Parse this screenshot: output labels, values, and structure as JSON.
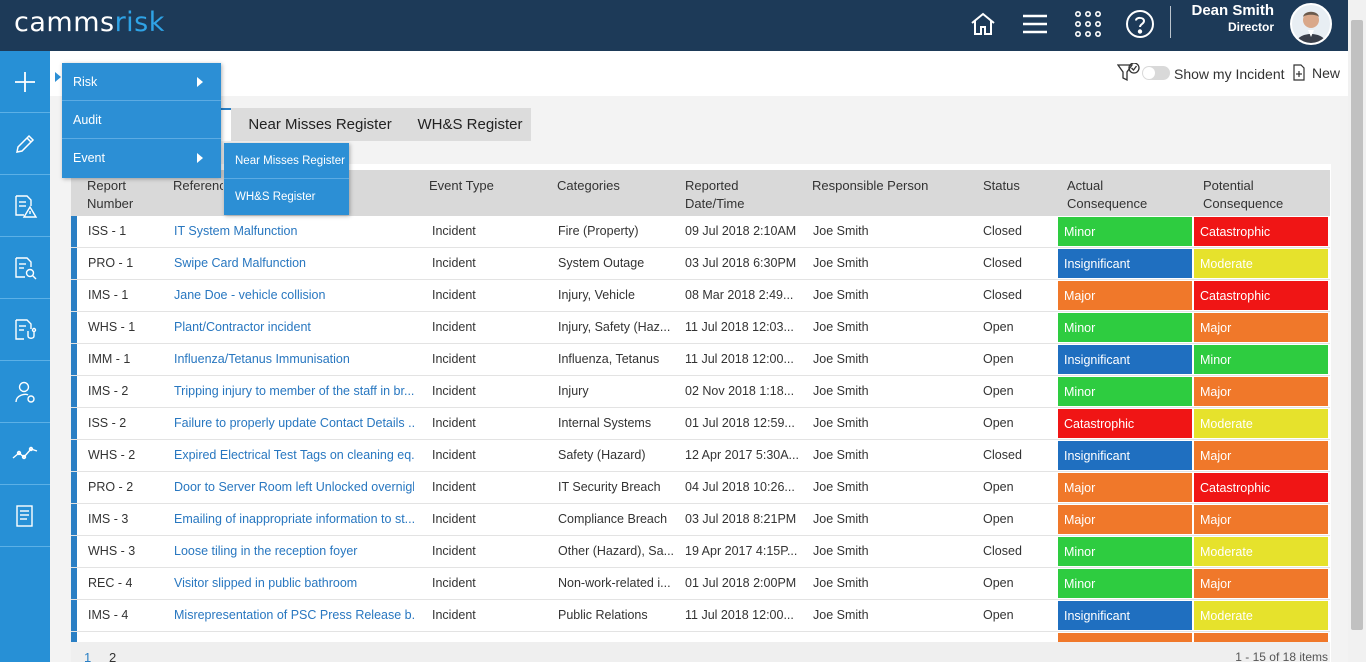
{
  "app": {
    "logo_main": "camms",
    "logo_accent": "risk"
  },
  "user": {
    "name": "Dean Smith",
    "role": "Director"
  },
  "toolbar": {
    "show_label": "Show my Incident",
    "new_label": "New"
  },
  "tabs": [
    {
      "label": "Near Misses Register"
    },
    {
      "label": "WH&S Register"
    }
  ],
  "menu": {
    "items": [
      {
        "label": "Risk"
      },
      {
        "label": "Audit"
      },
      {
        "label": "Event"
      }
    ],
    "submenu": [
      {
        "label": "Near Misses Register"
      },
      {
        "label": "WH&S Register"
      }
    ]
  },
  "grid": {
    "headers": {
      "report_number": "Report Number",
      "reference": "Referenc",
      "event_type": "Event Type",
      "categories": "Categories",
      "reported": "Reported Date/Time",
      "responsible": "Responsible Person",
      "status": "Status",
      "actual": "Actual Consequence",
      "potential": "Potential Consequence"
    },
    "rows": [
      {
        "num": "ISS - 1",
        "title": "IT System Malfunction",
        "type": "Incident",
        "cat": "Fire (Property)",
        "date": "09 Jul 2018 2:10AM",
        "person": "Joe Smith",
        "status": "Closed",
        "actual": "Minor",
        "potential": "Catastrophic"
      },
      {
        "num": "PRO - 1",
        "title": "Swipe Card Malfunction",
        "type": "Incident",
        "cat": "System Outage",
        "date": "03 Jul 2018 6:30PM",
        "person": "Joe Smith",
        "status": "Closed",
        "actual": "Insignificant",
        "potential": "Moderate"
      },
      {
        "num": "IMS - 1",
        "title": "Jane Doe - vehicle collision",
        "type": "Incident",
        "cat": "Injury, Vehicle",
        "date": "08 Mar 2018 2:49...",
        "person": "Joe Smith",
        "status": "Closed",
        "actual": "Major",
        "potential": "Catastrophic"
      },
      {
        "num": "WHS - 1",
        "title": "Plant/Contractor incident",
        "type": "Incident",
        "cat": "Injury, Safety (Haz...",
        "date": "11 Jul 2018 12:03...",
        "person": "Joe Smith",
        "status": "Open",
        "actual": "Minor",
        "potential": "Major"
      },
      {
        "num": "IMM - 1",
        "title": "Influenza/Tetanus Immunisation",
        "type": "Incident",
        "cat": "Influenza, Tetanus",
        "date": "11 Jul 2018 12:00...",
        "person": "Joe Smith",
        "status": "Open",
        "actual": "Insignificant",
        "potential": "Minor"
      },
      {
        "num": "IMS - 2",
        "title": "Tripping injury to member of the staff in br...",
        "type": "Incident",
        "cat": "Injury",
        "date": "02 Nov 2018 1:18...",
        "person": "Joe Smith",
        "status": "Open",
        "actual": "Minor",
        "potential": "Major"
      },
      {
        "num": "ISS - 2",
        "title": "Failure to properly update Contact Details ...",
        "type": "Incident",
        "cat": "Internal Systems",
        "date": "01 Jul 2018 12:59...",
        "person": "Joe Smith",
        "status": "Open",
        "actual": "Catastrophic",
        "potential": "Moderate"
      },
      {
        "num": "WHS - 2",
        "title": "Expired Electrical Test Tags on cleaning eq...",
        "type": "Incident",
        "cat": "Safety (Hazard)",
        "date": "12 Apr 2017 5:30A...",
        "person": "Joe Smith",
        "status": "Closed",
        "actual": "Insignificant",
        "potential": "Major"
      },
      {
        "num": "PRO - 2",
        "title": "Door to Server Room left Unlocked overnight",
        "type": "Incident",
        "cat": "IT Security Breach",
        "date": "04 Jul 2018 10:26...",
        "person": "Joe Smith",
        "status": "Open",
        "actual": "Major",
        "potential": "Catastrophic"
      },
      {
        "num": "IMS - 3",
        "title": "Emailing of inappropriate information to st...",
        "type": "Incident",
        "cat": "Compliance Breach",
        "date": "03 Jul 2018 8:21PM",
        "person": "Joe Smith",
        "status": "Open",
        "actual": "Major",
        "potential": "Major"
      },
      {
        "num": "WHS - 3",
        "title": "Loose tiling in the reception foyer",
        "type": "Incident",
        "cat": "Other (Hazard), Sa...",
        "date": "19 Apr 2017 4:15P...",
        "person": "Joe Smith",
        "status": "Closed",
        "actual": "Minor",
        "potential": "Moderate"
      },
      {
        "num": "REC - 4",
        "title": "Visitor slipped in public bathroom",
        "type": "Incident",
        "cat": "Non-work-related i...",
        "date": "01 Jul 2018 2:00PM",
        "person": "Joe Smith",
        "status": "Open",
        "actual": "Minor",
        "potential": "Major"
      },
      {
        "num": "IMS - 4",
        "title": "Misrepresentation of PSC Press Release b...",
        "type": "Incident",
        "cat": "Public Relations",
        "date": "11 Jul 2018 12:00...",
        "person": "Joe Smith",
        "status": "Open",
        "actual": "Insignificant",
        "potential": "Moderate"
      }
    ]
  },
  "pager": {
    "page1": "1",
    "page2": "2",
    "summary": "1 - 15 of 18 items"
  },
  "colors": {
    "Minor": "#2ecc40",
    "Insignificant": "#1f6fc0",
    "Major": "#f0782a",
    "Catastrophic": "#f01515",
    "Moderate": "#e6e22c"
  }
}
